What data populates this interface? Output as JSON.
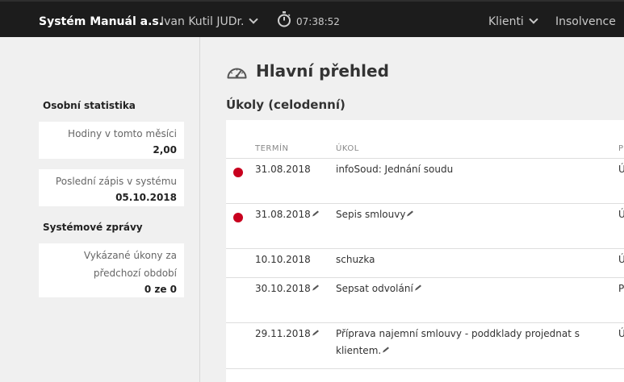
{
  "topbar": {
    "brand": "Systém Manuál a.s.",
    "user": "Ivan Kutil JUDr.",
    "time": "07:38:52",
    "nav": [
      "Klienti",
      "Insolvence"
    ]
  },
  "sidebar": {
    "personal_heading": "Osobní statistika",
    "stats": [
      {
        "label": "Hodiny v tomto měsíci",
        "value": "2,00"
      },
      {
        "label": "Poslední zápis v systému",
        "value": "05.10.2018"
      }
    ],
    "system_heading": "Systémové zprávy",
    "messages": [
      {
        "label_line1": "Vykázané úkony za",
        "label_line2": "předchozí období",
        "value": "0 ze 0"
      }
    ]
  },
  "main": {
    "title": "Hlavní přehled",
    "section": "Úkoly (celodenní)",
    "columns": [
      "TERMÍN",
      "ÚKOL",
      "P"
    ],
    "rows": [
      {
        "date": "31.08.2018",
        "task": "infoSoud: Jednání soudu",
        "trunc": "Ú"
      },
      {
        "date": "31.08.2018",
        "task": "Sepis smlouvy",
        "trunc": "Ú"
      },
      {
        "date": "10.10.2018",
        "task": "schuzka",
        "trunc": "Ú"
      },
      {
        "date": "30.10.2018",
        "task": "Sepsat odvolání",
        "trunc": "P"
      },
      {
        "date": "29.11.2018",
        "task": "Příprava najemní smlouvy - poddklady projednat s klientem.",
        "trunc": "Ú"
      }
    ]
  },
  "colors": {
    "topbar": "#1c1c1c",
    "priority_dot": "#c8001e"
  }
}
